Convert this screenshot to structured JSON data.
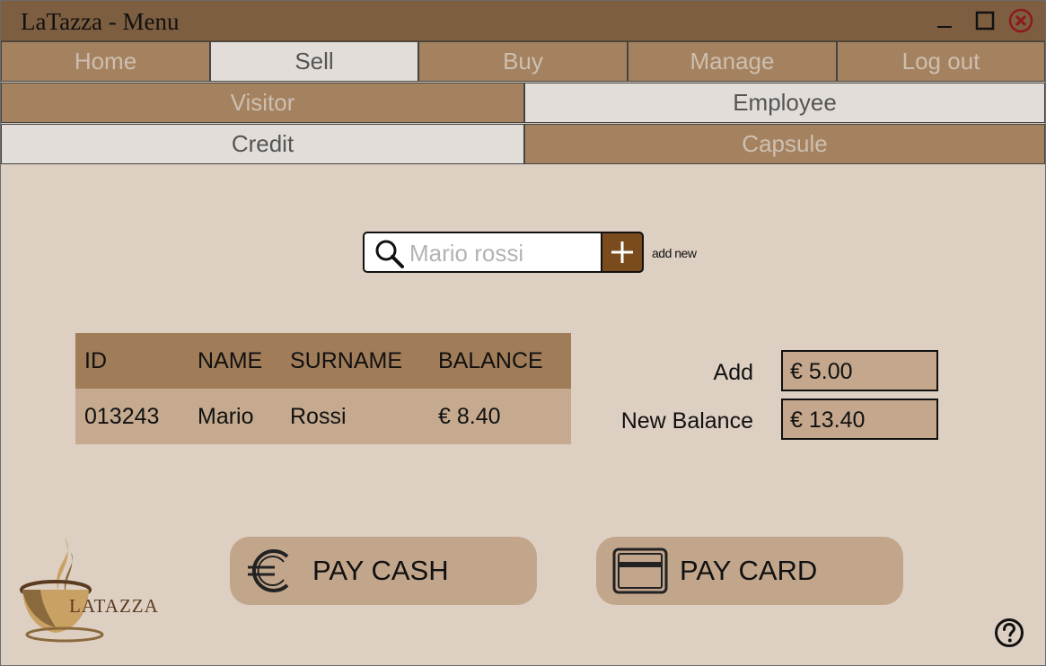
{
  "window": {
    "title": "LaTazza - Menu"
  },
  "nav": {
    "main_tabs": [
      {
        "label": "Home",
        "active": false
      },
      {
        "label": "Sell",
        "active": true
      },
      {
        "label": "Buy",
        "active": false
      },
      {
        "label": "Manage",
        "active": false
      },
      {
        "label": "Log out",
        "active": false
      }
    ],
    "customer_tabs": [
      {
        "label": "Visitor",
        "active": false
      },
      {
        "label": "Employee",
        "active": true
      }
    ],
    "type_tabs": [
      {
        "label": "Credit",
        "active": true
      },
      {
        "label": "Capsule",
        "active": false
      }
    ]
  },
  "search": {
    "placeholder": "Mario rossi",
    "add_label": "add new"
  },
  "table": {
    "headers": [
      "ID",
      "NAME",
      "SURNAME",
      "BALANCE"
    ],
    "rows": [
      [
        "013243",
        "Mario",
        "Rossi",
        "€ 8.40"
      ]
    ]
  },
  "form": {
    "add_label": "Add",
    "add_value": "€ 5.00",
    "new_balance_label": "New Balance",
    "new_balance_value": "€ 13.40"
  },
  "actions": {
    "pay_cash": "PAY CASH",
    "pay_card": "PAY CARD"
  },
  "logo": {
    "text": "LATAZZA"
  },
  "colors": {
    "accent": "#7a4b1c",
    "titlebar": "#7d5e41",
    "tab": "#a5825f",
    "tab_active": "#e2ddd8"
  }
}
